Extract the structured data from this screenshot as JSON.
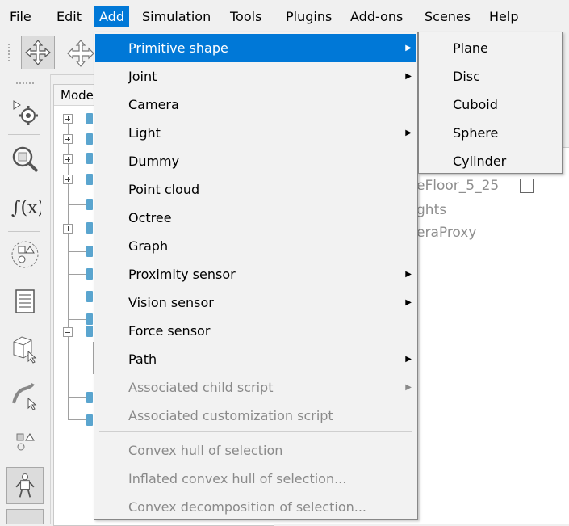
{
  "menubar": {
    "items": [
      "File",
      "Edit",
      "Add",
      "Simulation",
      "Tools",
      "Plugins",
      "Add-ons",
      "Scenes",
      "Help"
    ],
    "active": "Add"
  },
  "hierarchy": {
    "header": "Mode"
  },
  "scene": {
    "rows": [
      "eFloor_5_25",
      "ghts",
      "eraProxy"
    ]
  },
  "add_menu": {
    "items": [
      {
        "label": "Primitive shape",
        "submenu": true,
        "highlighted": true,
        "disabled": false
      },
      {
        "label": "Joint",
        "submenu": true,
        "disabled": false
      },
      {
        "label": "Camera",
        "submenu": false,
        "disabled": false
      },
      {
        "label": "Light",
        "submenu": true,
        "disabled": false
      },
      {
        "label": "Dummy",
        "submenu": false,
        "disabled": false
      },
      {
        "label": "Point cloud",
        "submenu": false,
        "disabled": false
      },
      {
        "label": "Octree",
        "submenu": false,
        "disabled": false
      },
      {
        "label": "Graph",
        "submenu": false,
        "disabled": false
      },
      {
        "label": "Proximity sensor",
        "submenu": true,
        "disabled": false
      },
      {
        "label": "Vision sensor",
        "submenu": true,
        "disabled": false
      },
      {
        "label": "Force sensor",
        "submenu": false,
        "disabled": false
      },
      {
        "label": "Path",
        "submenu": true,
        "disabled": false
      },
      {
        "label": "Associated child script",
        "submenu": true,
        "disabled": true
      },
      {
        "label": "Associated customization script",
        "submenu": false,
        "disabled": true
      },
      {
        "label": "Convex hull of selection",
        "submenu": false,
        "disabled": true
      },
      {
        "label": "Inflated convex hull of selection...",
        "submenu": false,
        "disabled": true
      },
      {
        "label": "Convex decomposition of selection...",
        "submenu": false,
        "disabled": true
      }
    ]
  },
  "primitive_submenu": {
    "items": [
      "Plane",
      "Disc",
      "Cuboid",
      "Sphere",
      "Cylinder"
    ]
  },
  "colors": {
    "highlight": "#0078d7",
    "disabled_text": "#8a8a8a",
    "object_icon": "#5aa5cf"
  }
}
